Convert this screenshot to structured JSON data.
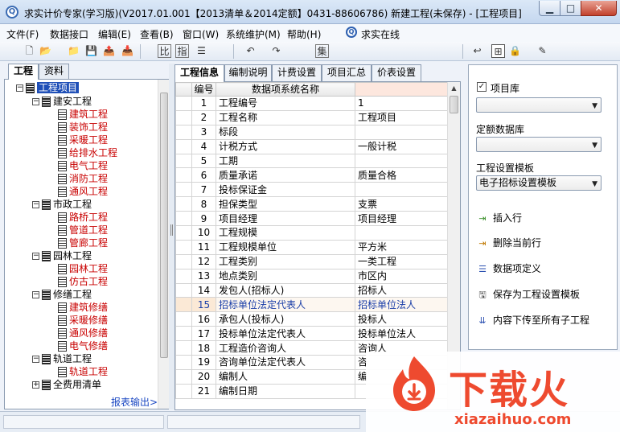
{
  "window": {
    "title": "求实计价专家(学习版)(V2017.01.001【2013清单＆2014定额】0431-88606786) 新建工程(未保存) - [工程项目]",
    "icon_label": "Q",
    "minimize": "▁",
    "maximize": "□",
    "close": "✕"
  },
  "menu": {
    "items": [
      "文件(F)",
      "数据接口",
      "编辑(E)",
      "查看(B)",
      "窗口(W)",
      "系统维护(M)",
      "帮助(H)"
    ],
    "online": "求实在线"
  },
  "toolbar": {
    "icons": [
      "new-file-icon",
      "open-folder-icon",
      "folder-icon",
      "save-icon",
      "export-icon",
      "import-icon",
      "compare-icon",
      "table-icon",
      "list-icon",
      "undo-icon",
      "redo-icon",
      "calc-icon",
      "back-icon",
      "tree-icon",
      "lock-icon",
      "pen-icon"
    ],
    "glyphs": [
      "🗋",
      "📂",
      "📁",
      "💾",
      "📤",
      "📥",
      "比",
      "指",
      "☰",
      "↶",
      "↷",
      "集",
      "↩",
      "⊞",
      "🔒",
      "✎"
    ]
  },
  "left_panel": {
    "tabs": [
      "工程",
      "资料"
    ],
    "tree": {
      "root": "工程项目",
      "groups": [
        {
          "label": "建安工程",
          "children": [
            "建筑工程",
            "装饰工程",
            "采暖工程",
            "给排水工程",
            "电气工程",
            "消防工程",
            "通风工程"
          ]
        },
        {
          "label": "市政工程",
          "children": [
            "路桥工程",
            "管道工程",
            "管廊工程"
          ]
        },
        {
          "label": "园林工程",
          "children": [
            "园林工程",
            "仿古工程"
          ]
        },
        {
          "label": "修缮工程",
          "children": [
            "建筑修缮",
            "采暖修缮",
            "通风修缮",
            "电气修缮"
          ]
        },
        {
          "label": "轨道工程",
          "children": [
            "轨道工程"
          ]
        },
        {
          "label": "全费用清单",
          "children": []
        }
      ]
    },
    "report_link": "报表输出>>"
  },
  "center": {
    "tabs": [
      "工程信息",
      "编制说明",
      "计费设置",
      "项目汇总",
      "价表设置"
    ],
    "grid": {
      "headers": [
        "编号",
        "数据项系统名称",
        ""
      ],
      "rows": [
        [
          "1",
          "工程编号",
          "1"
        ],
        [
          "2",
          "工程名称",
          "工程项目"
        ],
        [
          "3",
          "标段",
          ""
        ],
        [
          "4",
          "计税方式",
          "一般计税"
        ],
        [
          "5",
          "工期",
          ""
        ],
        [
          "6",
          "质量承诺",
          "质量合格"
        ],
        [
          "7",
          "投标保证金",
          ""
        ],
        [
          "8",
          "担保类型",
          "支票"
        ],
        [
          "9",
          "项目经理",
          "项目经理"
        ],
        [
          "10",
          "工程规模",
          ""
        ],
        [
          "11",
          "工程规模单位",
          "平方米"
        ],
        [
          "12",
          "工程类别",
          "一类工程"
        ],
        [
          "13",
          "地点类别",
          "市区内"
        ],
        [
          "14",
          "发包人(招标人)",
          "招标人"
        ],
        [
          "15",
          "招标单位法定代表人",
          "招标单位法人"
        ],
        [
          "16",
          "承包人(投标人)",
          "投标人"
        ],
        [
          "17",
          "投标单位法定代表人",
          "投标单位法人"
        ],
        [
          "18",
          "工程造价咨询人",
          "咨询人"
        ],
        [
          "19",
          "咨询单位法定代表人",
          "咨"
        ],
        [
          "20",
          "编制人",
          "编"
        ],
        [
          "21",
          "编制日期",
          ""
        ]
      ],
      "selected_row": 14
    }
  },
  "right_panel": {
    "project_lib_checked": true,
    "project_lib_label": "项目库",
    "project_lib_value": "",
    "quota_db_label": "定额数据库",
    "quota_db_value": "",
    "template_label": "工程设置模板",
    "template_value": "电子招标设置模板",
    "actions": [
      {
        "icon": "insert-row-icon",
        "label": "插入行"
      },
      {
        "icon": "delete-row-icon",
        "label": "删除当前行"
      },
      {
        "icon": "define-icon",
        "label": "数据项定义"
      },
      {
        "icon": "save-template-icon",
        "label": "保存为工程设置模板"
      },
      {
        "icon": "push-down-icon",
        "label": "内容下传至所有子工程"
      }
    ]
  },
  "watermark": {
    "name": "下载火",
    "url": "xiazaihuo.com"
  },
  "colors": {
    "selected_root": "#1f4fb7",
    "red_text": "#c80000",
    "link": "#1a47c2",
    "watermark": "#ee4a2f"
  }
}
